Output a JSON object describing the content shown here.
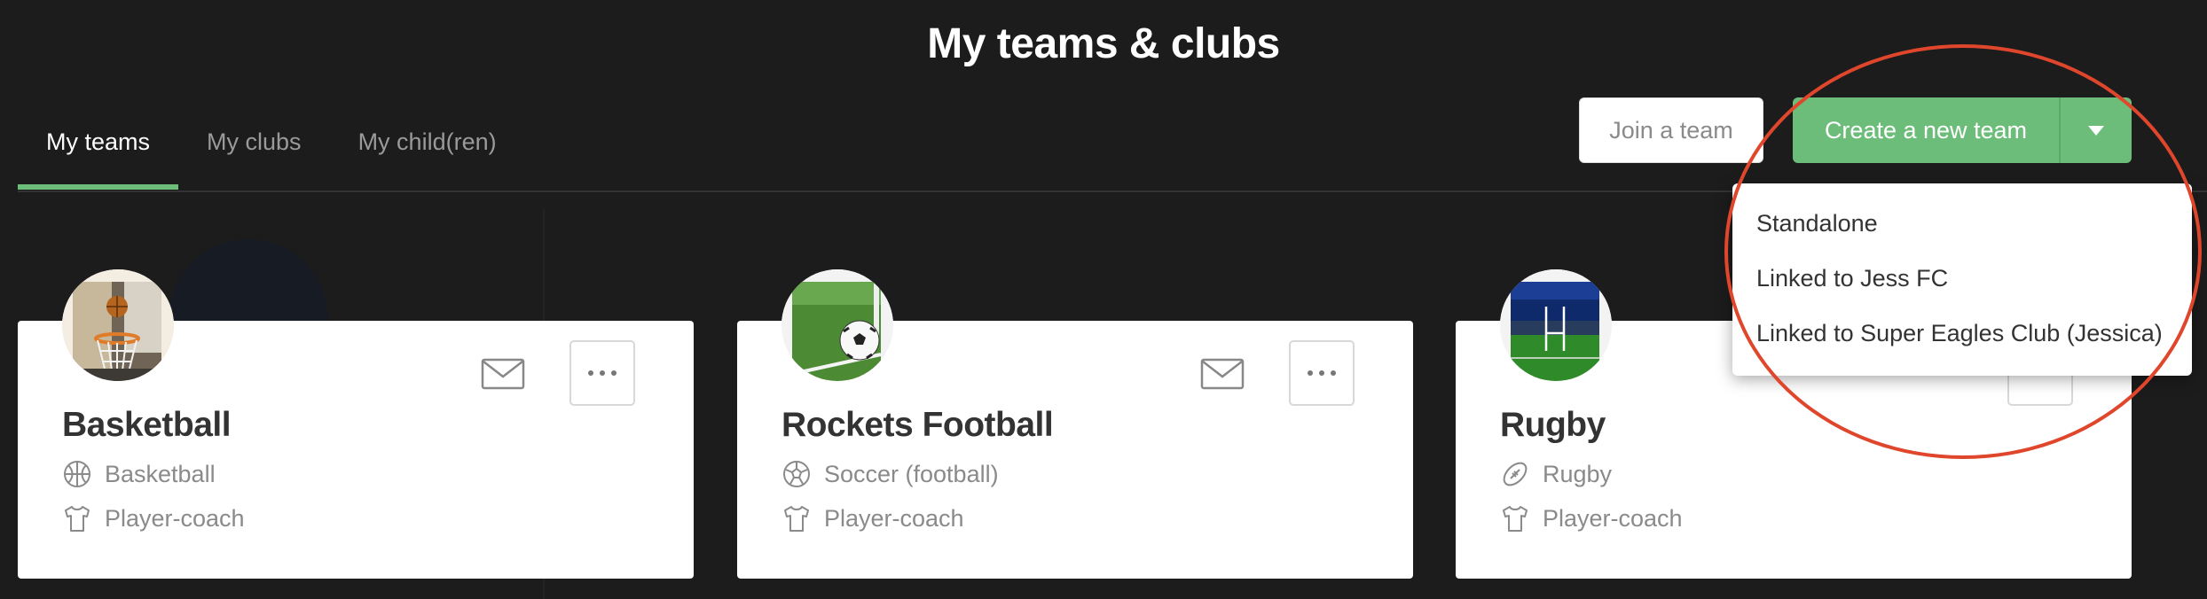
{
  "page": {
    "title": "My teams & clubs"
  },
  "tabs": [
    {
      "label": "My teams",
      "active": true
    },
    {
      "label": "My clubs",
      "active": false
    },
    {
      "label": "My child(ren)",
      "active": false
    }
  ],
  "actions": {
    "join_label": "Join a team",
    "create_label": "Create a new team"
  },
  "create_menu": {
    "items": [
      "Standalone",
      "Linked to Jess FC",
      "Linked to Super Eagles Club (Jessica)"
    ]
  },
  "teams": [
    {
      "name": "Basketball",
      "sport": "Basketball",
      "role": "Player-coach",
      "sport_icon": "basketball-icon"
    },
    {
      "name": "Rockets Football",
      "sport": "Soccer (football)",
      "role": "Player-coach",
      "sport_icon": "soccer-ball-icon"
    },
    {
      "name": "Rugby",
      "sport": "Rugby",
      "role": "Player-coach",
      "sport_icon": "rugby-ball-icon"
    }
  ],
  "colors": {
    "accent": "#6dbd7a",
    "background": "#1c1c1c",
    "highlight": "#e0462c"
  }
}
